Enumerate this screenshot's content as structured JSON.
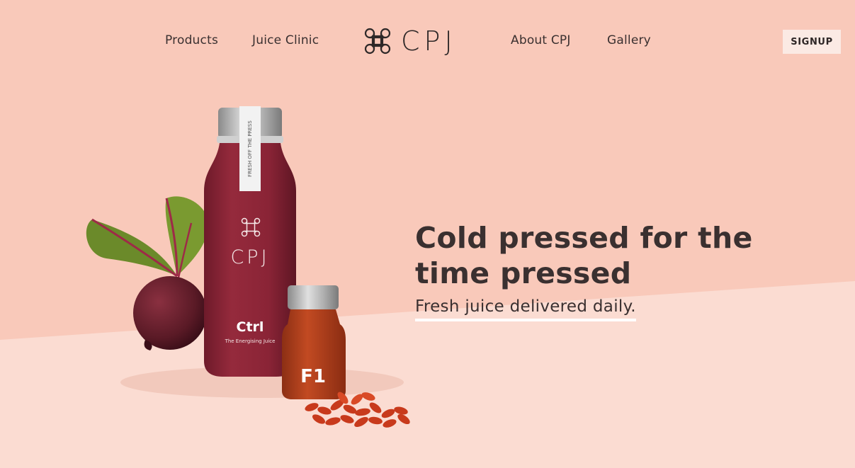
{
  "nav": {
    "left_links": [
      "Products",
      "Juice Clinic"
    ],
    "right_links": [
      "About CPJ",
      "Gallery"
    ],
    "logo_text": "CPJ",
    "signup_label": "SIGNUP"
  },
  "hero": {
    "title": "Cold pressed for the time pressed",
    "subtitle": "Fresh juice delivered daily."
  },
  "products": {
    "big_bottle_band": "FRESH OFF THE PRESS",
    "big_bottle_brand": "CPJ",
    "big_bottle_name": "Ctrl",
    "big_bottle_desc": "The Energising Juice",
    "small_bottle_name": "F1"
  },
  "colors": {
    "background_top": "#f9c9ba",
    "background_bottom": "#fbdcd2",
    "text": "#3a3030",
    "bottle_red": "#8c2436",
    "small_bottle_orange": "#b8431f"
  }
}
